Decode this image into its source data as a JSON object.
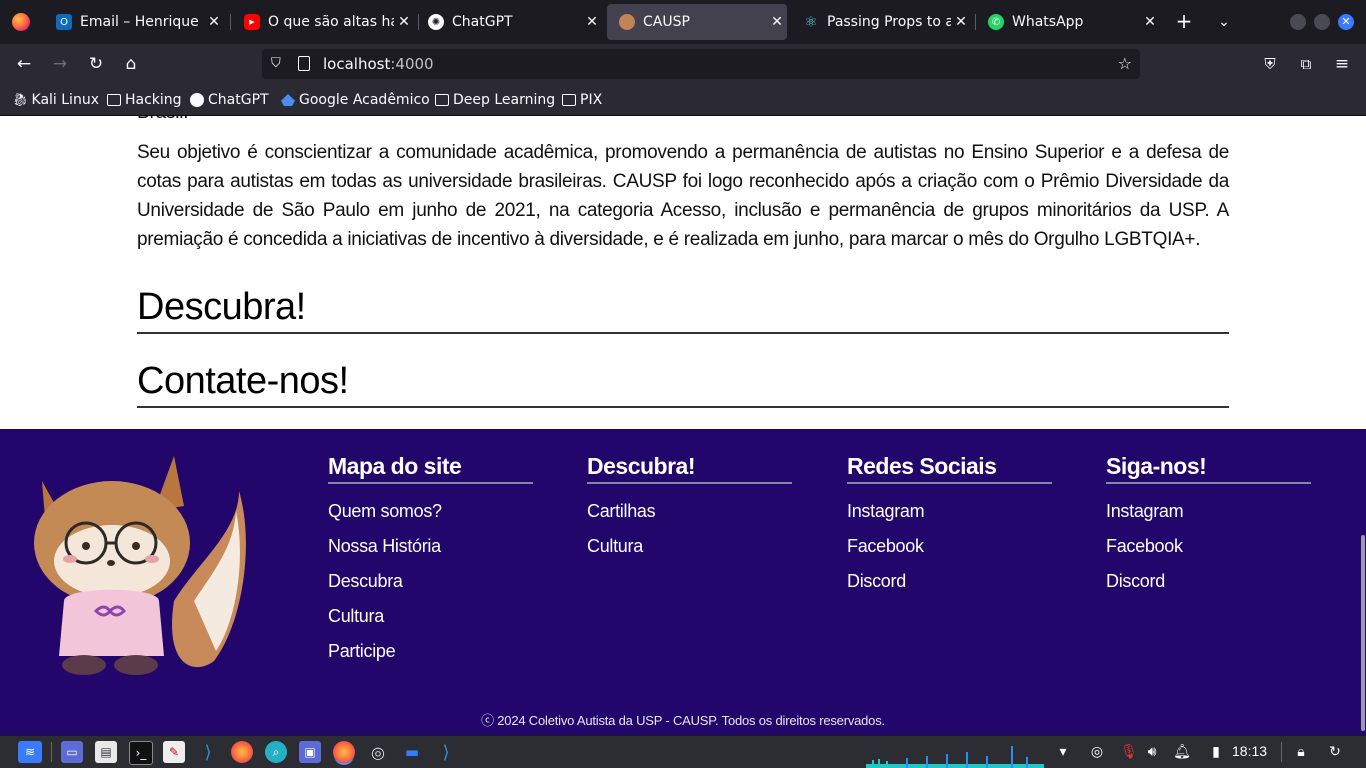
{
  "browser": {
    "tabs": [
      {
        "title": "Email – Henrique Ed",
        "icon": "outlook-icon"
      },
      {
        "title": "O que são altas hab",
        "icon": "youtube-icon"
      },
      {
        "title": "ChatGPT",
        "icon": "chatgpt-icon"
      },
      {
        "title": "CAUSP",
        "icon": "causp-icon",
        "active": true
      },
      {
        "title": "Passing Props to a C",
        "icon": "react-icon"
      },
      {
        "title": "WhatsApp",
        "icon": "whatsapp-icon"
      }
    ],
    "url_host": "localhost",
    "url_port": ":4000",
    "bookmarks": [
      {
        "label": "Kali Linux",
        "icon": "kali-icon"
      },
      {
        "label": "Hacking",
        "icon": "folder-icon"
      },
      {
        "label": "ChatGPT",
        "icon": "chatgpt-icon"
      },
      {
        "label": "Google Acadêmico",
        "icon": "scholar-icon"
      },
      {
        "label": "Deep Learning",
        "icon": "folder-icon"
      },
      {
        "label": "PIX",
        "icon": "folder-icon"
      }
    ]
  },
  "page": {
    "cut_text": "Brasil.",
    "paragraph": "Seu objetivo é conscientizar a comunidade acadêmica, promovendo a permanência de autistas no Ensino Superior e a defesa de cotas para autistas em todas as universidade brasileiras. CAUSP foi logo reconhecido após a criação com o Prêmio Diversidade da Universidade de São Paulo em junho de 2021, na categoria Acesso, inclusão e permanência de grupos minoritários da USP. A premiação é concedida a iniciativas de incentivo à diversidade, e é realizada em junho, para marcar o mês do Orgulho LGBTQIA+.",
    "heading_discover": "Descubra!",
    "heading_contact": "Contate-nos!"
  },
  "footer": {
    "columns": [
      {
        "title": "Mapa do site",
        "links": [
          "Quem somos?",
          "Nossa História",
          "Descubra",
          "Cultura",
          "Participe"
        ]
      },
      {
        "title": "Descubra!",
        "links": [
          "Cartilhas",
          "Cultura"
        ]
      },
      {
        "title": "Redes Sociais",
        "links": [
          "Instagram",
          "Facebook",
          "Discord"
        ]
      },
      {
        "title": "Siga-nos!",
        "links": [
          "Instagram",
          "Facebook",
          "Discord"
        ]
      }
    ],
    "copyright": "ⓒ 2024 Coletivo Autista da USP - CAUSP. Todos os direitos reservados.",
    "bg_color": "#23066b"
  },
  "taskbar": {
    "clock": "18:13"
  }
}
